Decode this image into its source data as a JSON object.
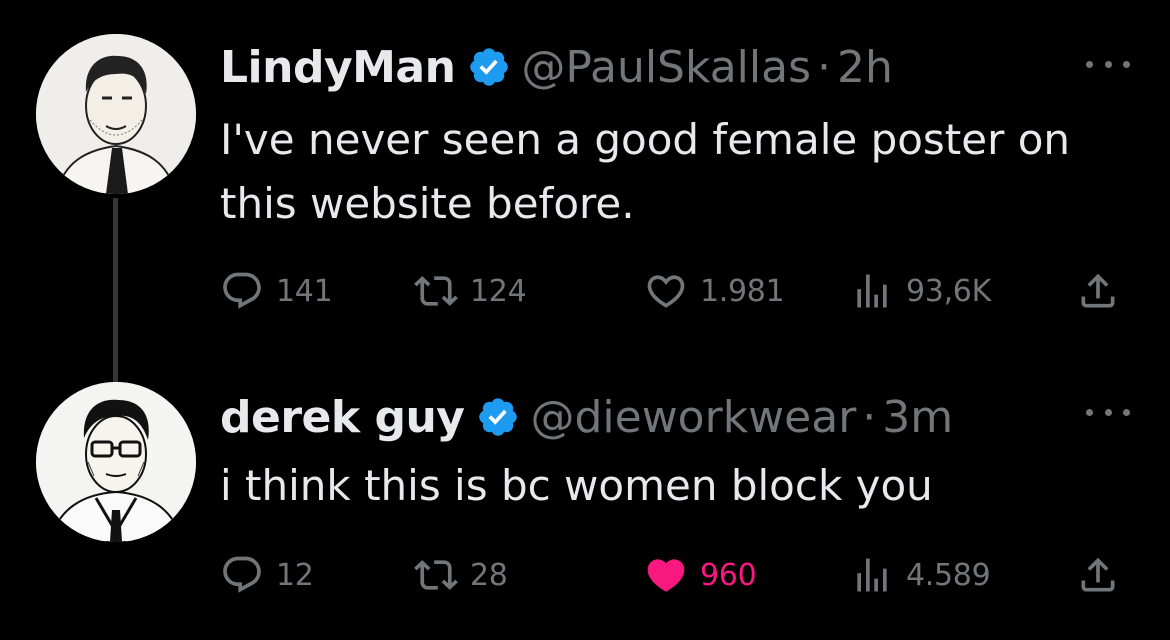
{
  "tweets": [
    {
      "display_name": "LindyMan",
      "verified": true,
      "handle": "@PaulSkallas",
      "separator": "·",
      "time": "2h",
      "text": "I've never seen a good female poster on this website before.",
      "replies": "141",
      "retweets": "124",
      "likes": "1.981",
      "views": "93,6K",
      "liked": false
    },
    {
      "display_name": "derek guy",
      "verified": true,
      "handle": "@dieworkwear",
      "separator": "·",
      "time": "3m",
      "text": "i think this is bc women block you",
      "replies": "12",
      "retweets": "28",
      "likes": "960",
      "views": "4.589",
      "liked": true
    }
  ],
  "colors": {
    "background": "#000000",
    "primary_text": "#e7e9ea",
    "secondary_text": "#71767b",
    "verified_badge": "#1d9bf0",
    "like_active": "#f91880",
    "thread_line": "#333639"
  },
  "icons": [
    "verified-badge-icon",
    "more-icon",
    "reply-icon",
    "retweet-icon",
    "like-icon",
    "views-icon",
    "share-icon"
  ]
}
